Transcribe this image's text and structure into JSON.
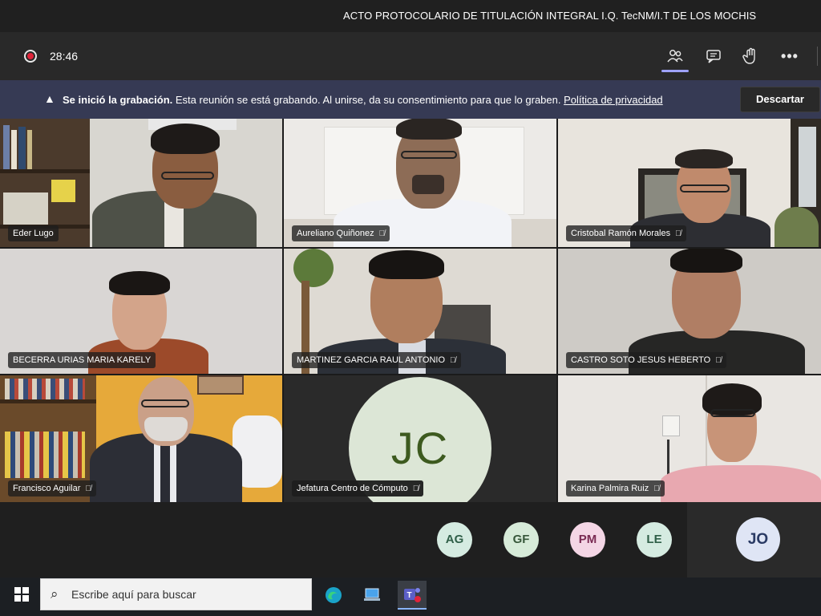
{
  "window": {
    "title": "ACTO PROTOCOLARIO DE TITULACIÓN INTEGRAL I.Q. TecNM/I.T DE LOS MOCHIS"
  },
  "toolbar": {
    "timer": "28:46",
    "icons": [
      "recording-icon",
      "participants-icon",
      "chat-icon",
      "raise-hand-icon",
      "more-icon"
    ]
  },
  "banner": {
    "bold": "Se inició la grabación.",
    "message": " Esta reunión se está grabando. Al unirse, da su consentimiento para que lo graben. ",
    "link": "Política de privacidad",
    "dismiss": "Descartar"
  },
  "participants": [
    {
      "name": "Eder Lugo"
    },
    {
      "name": "Aureliano Quiñonez"
    },
    {
      "name": "Cristobal Ramón Morales"
    },
    {
      "name": "BECERRA URIAS MARIA KARELY"
    },
    {
      "name": "MARTINEZ GARCIA RAUL ANTONIO"
    },
    {
      "name": "CASTRO SOTO JESUS HEBERTO"
    },
    {
      "name": "Francisco Aguilar"
    },
    {
      "name": "Jefatura Centro de Cómputo",
      "initials": "JC"
    },
    {
      "name": "Karina Palmira Ruiz"
    }
  ],
  "overflow_avatars": [
    {
      "initials": "AG",
      "bg": "#d5ebe1",
      "fg": "#2f5f48"
    },
    {
      "initials": "GF",
      "bg": "#d7ebd9",
      "fg": "#37573a"
    },
    {
      "initials": "PM",
      "bg": "#f4d6e5",
      "fg": "#7a2b53"
    },
    {
      "initials": "LE",
      "bg": "#d5ebe1",
      "fg": "#2f5f48"
    }
  ],
  "self_avatar": {
    "initials": "JO"
  },
  "taskbar": {
    "search_placeholder": "Escribe aquí para buscar"
  }
}
